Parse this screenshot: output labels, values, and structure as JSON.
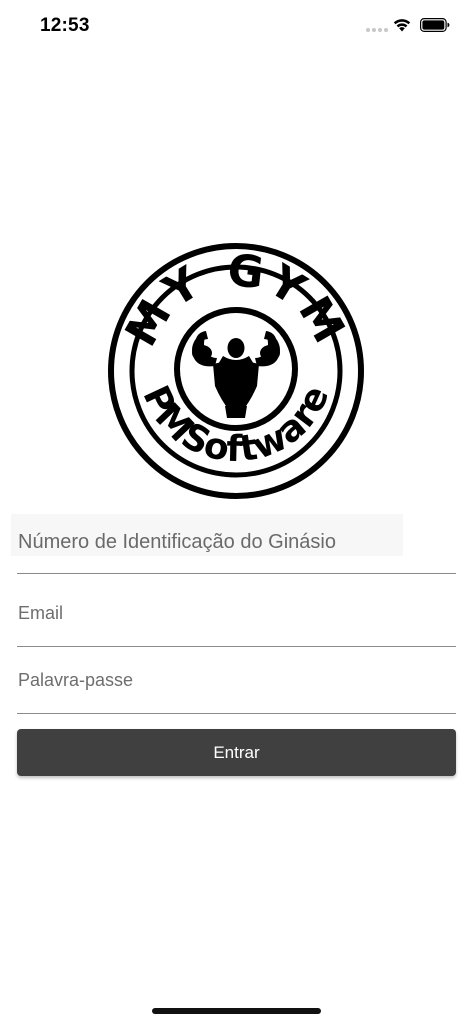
{
  "status_bar": {
    "time": "12:53",
    "icons": [
      "cellular-signal-icon",
      "wifi-icon",
      "battery-icon"
    ]
  },
  "logo": {
    "top_text": "MY GYM",
    "bottom_text": "PMSoftware",
    "icon": "bodybuilder-icon"
  },
  "form": {
    "gym_id_placeholder": "Número de Identificação do Ginásio",
    "email_placeholder": "Email",
    "password_placeholder": "Palavra-passe",
    "submit_label": "Entrar"
  },
  "colors": {
    "background": "#ffffff",
    "button": "#404040",
    "button_text": "#ffffff",
    "underline": "#8a8a8a",
    "placeholder": "#6e6e6e"
  }
}
